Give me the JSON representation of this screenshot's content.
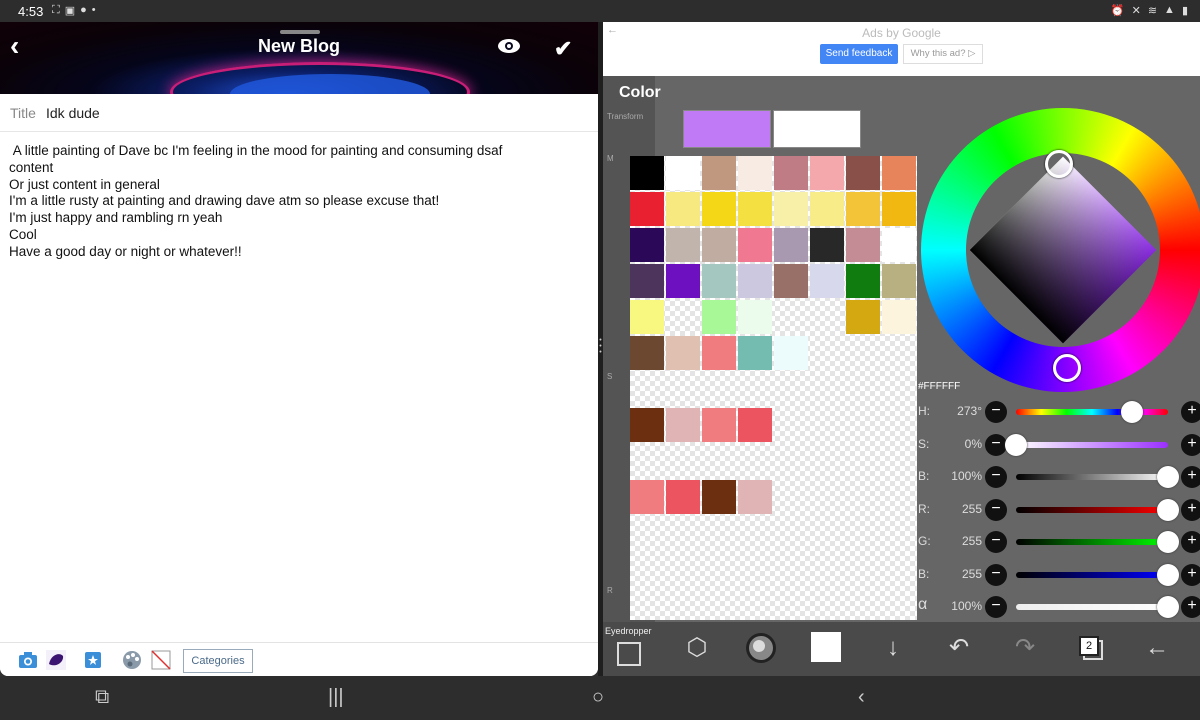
{
  "status_bar": {
    "time": "4:53",
    "left_icons": [
      "screenshot-icon",
      "image-icon",
      "pinterest-icon",
      "dot-icon"
    ],
    "right_icons": [
      "alarm-icon",
      "mute-icon",
      "wifi-icon",
      "signal-icon",
      "battery-icon"
    ]
  },
  "blog_editor": {
    "header_title": "New Blog",
    "title_label": "Title",
    "title_value": "Idk dude",
    "body_lines": [
      " A little painting of Dave bc I'm feeling in the mood for painting and consuming dsaf",
      "content",
      "Or just content in general",
      "I'm a little rusty at painting and drawing dave atm so please excuse that!",
      "I'm just happy and rambling rn yeah",
      "Cool",
      "Have a good day or night or whatever!!"
    ],
    "toolbar": {
      "categories_label": "Categories"
    }
  },
  "ad": {
    "ads_by": "Ads by Google",
    "send_feedback": "Send feedback",
    "why_this_ad": "Why this ad? ▷"
  },
  "paint_app": {
    "sidebar_labels": {
      "transform": "Transform",
      "m": "M",
      "s": "S",
      "r": "R"
    },
    "color_title": "Color",
    "current_color": "#c07af5",
    "previous_color": "#ffffff",
    "hex": "#FFFFFF",
    "sliders": [
      {
        "label": "H:",
        "value": "273°",
        "fill": 0.76,
        "gradient": "linear-gradient(to right,#f00,#ff0,#0f0,#0ff,#00f,#f0f,#f00)"
      },
      {
        "label": "S:",
        "value": "0%",
        "fill": 0.0,
        "gradient": "linear-gradient(to right,#fff,#9b30ff)"
      },
      {
        "label": "B:",
        "value": "100%",
        "fill": 1.0,
        "gradient": "linear-gradient(to right,#000,#fff)"
      },
      {
        "label": "R:",
        "value": "255",
        "fill": 1.0,
        "gradient": "linear-gradient(to right,#000,#f00)"
      },
      {
        "label": "G:",
        "value": "255",
        "fill": 1.0,
        "gradient": "linear-gradient(to right,#000,#0f0)"
      },
      {
        "label": "B:",
        "value": "255",
        "fill": 1.0,
        "gradient": "linear-gradient(to right,#000,#00f)"
      },
      {
        "label": "α",
        "value": "100%",
        "fill": 1.0,
        "gradient": "linear-gradient(to right,#eee,#fff)"
      }
    ],
    "palette_rows": [
      [
        "#000000",
        "#ffffff",
        "#c09880",
        "#f8ebe4",
        "#c07c84",
        "#f4a8ac",
        "#885048",
        "#e8845c"
      ],
      [
        "#e82030",
        "#f8e880",
        "#f4d818",
        "#f4e040",
        "#f8f0a8",
        "#f8ec88",
        "#f4c438",
        "#f0b810"
      ],
      [
        "#2c0858",
        "#c0b4ac",
        "#c0aca0",
        "#f07890",
        "#a898b0",
        "#282828",
        "#c48c94",
        "#ffffff"
      ],
      [
        "#4c345c",
        "#6c10c0",
        "#a4c8c0",
        "#ccc8e0",
        "#987068",
        "#d8d8ec",
        "#107c10",
        "#b8b080"
      ],
      [
        "#f8f880",
        "",
        "#a8f898",
        "#ecfcec",
        "",
        "",
        "#d4a810",
        "#fcf4dc"
      ],
      [
        "#6c4830",
        "#e0c0b0",
        "#f07c80",
        "#74bcb0",
        "#ecfcfc",
        "",
        "",
        ""
      ],
      [
        "",
        "",
        "",
        "",
        "",
        "",
        "",
        ""
      ],
      [
        "#6c3010",
        "#e0b4b4",
        "#f07c80",
        "#ec5460",
        "",
        "",
        "",
        ""
      ],
      [
        "",
        "",
        "",
        "",
        "",
        "",
        "",
        ""
      ],
      [
        "#f07c80",
        "#ec5460",
        "#6c3010",
        "#e0b4b4",
        "",
        "",
        "",
        ""
      ]
    ],
    "bottom": {
      "eyedropper": "Eyedropper",
      "layers_count": "2"
    }
  }
}
